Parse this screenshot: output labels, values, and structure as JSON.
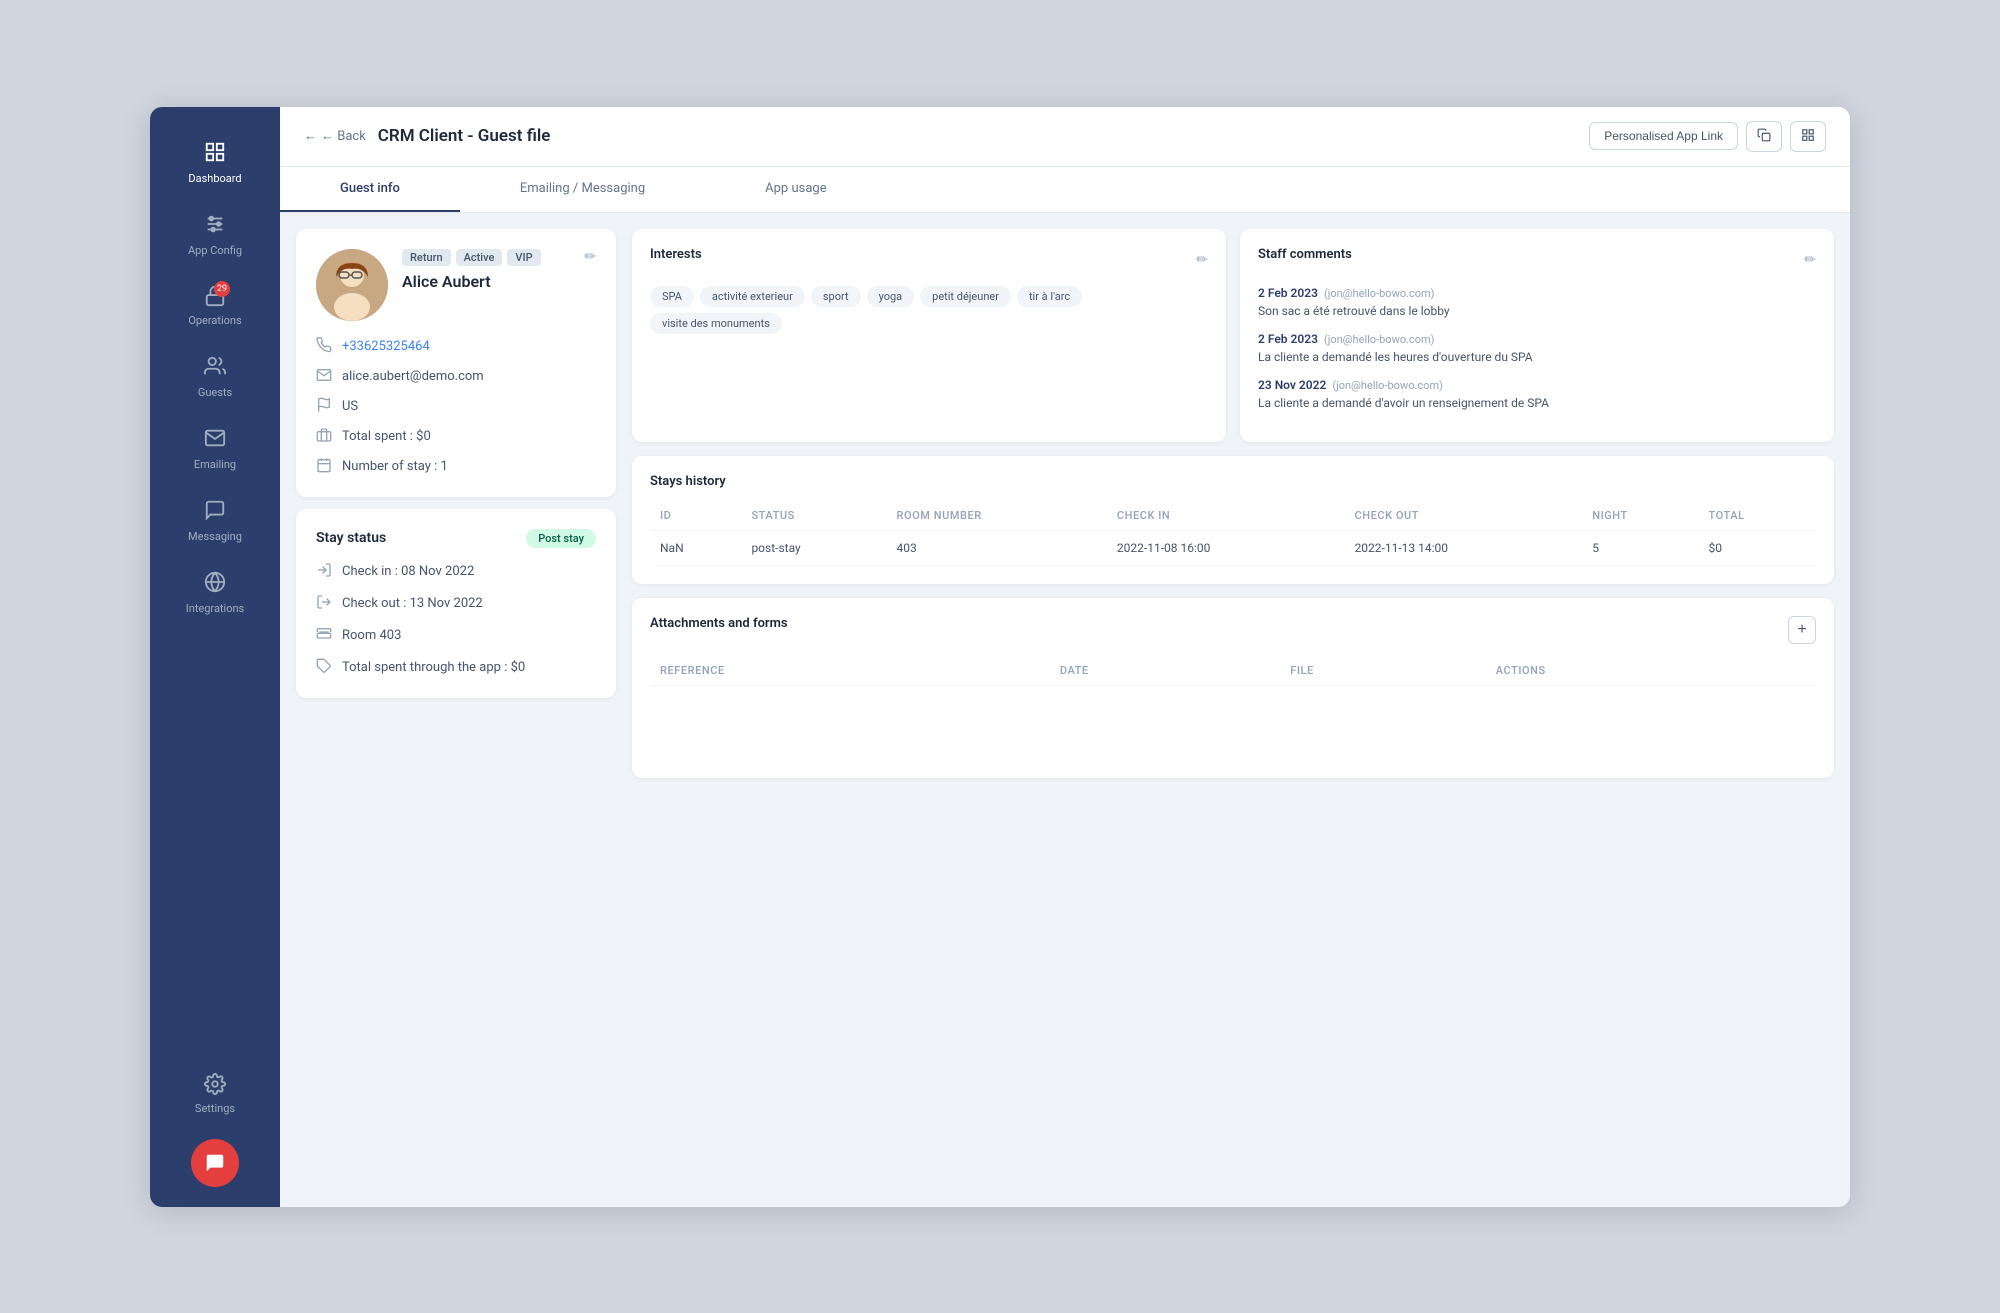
{
  "sidebar": {
    "items": [
      {
        "id": "dashboard",
        "label": "Dashboard",
        "icon": "grid"
      },
      {
        "id": "app-config",
        "label": "App Config",
        "icon": "sliders"
      },
      {
        "id": "operations",
        "label": "Operations",
        "icon": "lock",
        "badge": "29"
      },
      {
        "id": "guests",
        "label": "Guests",
        "icon": "users"
      },
      {
        "id": "emailing",
        "label": "Emailing",
        "icon": "mail"
      },
      {
        "id": "messaging",
        "label": "Messaging",
        "icon": "message-square"
      },
      {
        "id": "integrations",
        "label": "Integrations",
        "icon": "link"
      }
    ],
    "bottom": {
      "label": "Settings",
      "icon": "settings"
    },
    "chat_btn": "💬"
  },
  "topbar": {
    "back_label": "← Back",
    "title": "CRM Client - Guest file",
    "personalised_link": "Personalised App Link"
  },
  "tabs": [
    {
      "id": "guest-info",
      "label": "Guest info",
      "active": true
    },
    {
      "id": "emailing",
      "label": "Emailing / Messaging",
      "active": false
    },
    {
      "id": "app-usage",
      "label": "App usage",
      "active": false
    }
  ],
  "profile": {
    "name": "Alice Aubert",
    "tags": [
      "Return",
      "Active",
      "VIP"
    ],
    "phone": "+33625325464",
    "email": "alice.aubert@demo.com",
    "country": "US",
    "total_spent": "Total spent : $0",
    "number_of_stay": "Number of stay : 1"
  },
  "stay_status": {
    "title": "Stay status",
    "badge": "Post stay",
    "check_in_label": "Check in  : 08 Nov 2022",
    "check_out_label": "Check out : 13 Nov 2022",
    "room_label": "Room 403",
    "total_spent_label": "Total spent through the app : $0"
  },
  "interests": {
    "title": "Interests",
    "tags": [
      "SPA",
      "activité exterieur",
      "sport",
      "yoga",
      "petit déjeuner",
      "tir à l'arc",
      "visite des monuments"
    ]
  },
  "staff_comments": {
    "title": "Staff comments",
    "comments": [
      {
        "date": "2 Feb 2023",
        "author": "(jon@hello-bowo.com)",
        "text": "Son sac a été retrouvé dans le lobby"
      },
      {
        "date": "2 Feb 2023",
        "author": "(jon@hello-bowo.com)",
        "text": "La cliente a demandé les heures d'ouverture du SPA"
      },
      {
        "date": "23 Nov 2022",
        "author": "(jon@hello-bowo.com)",
        "text": "La cliente a demandé d'avoir un renseignement de SPA"
      }
    ]
  },
  "stays_history": {
    "title": "Stays history",
    "columns": [
      "ID",
      "STATUS",
      "ROOM NUMBER",
      "CHECK IN",
      "CHECK OUT",
      "NIGHT",
      "TOTAL"
    ],
    "rows": [
      {
        "id": "NaN",
        "status": "post-stay",
        "room_number": "403",
        "check_in": "2022-11-08 16:00",
        "check_out": "2022-11-13 14:00",
        "night": "5",
        "total": "$0"
      }
    ]
  },
  "attachments": {
    "title": "Attachments and forms",
    "columns": [
      "REFERENCE",
      "DATE",
      "FILE",
      "ACTIONS"
    ],
    "rows": []
  }
}
